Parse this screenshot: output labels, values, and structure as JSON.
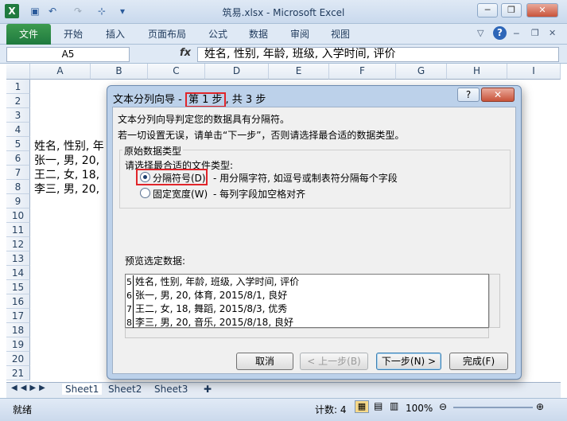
{
  "window": {
    "title": "筑易.xlsx - Microsoft Excel",
    "logo": "X",
    "qat": [
      "save-icon",
      "undo-icon",
      "redo-icon",
      "format-icon",
      "customize-icon"
    ],
    "controls": {
      "minimize": "─",
      "restore": "❐",
      "close": "✕"
    }
  },
  "ribbon": {
    "tabs": [
      "文件",
      "开始",
      "插入",
      "页面布局",
      "公式",
      "数据",
      "审阅",
      "视图"
    ]
  },
  "formula_bar": {
    "name_box": "A5",
    "fx": "fx",
    "content": "姓名, 性别, 年龄, 班级, 入学时间, 评价"
  },
  "sheet": {
    "columns": [
      "A",
      "B",
      "C",
      "D",
      "E",
      "F",
      "G",
      "H",
      "I"
    ],
    "rows": [
      "1",
      "2",
      "3",
      "4",
      "5",
      "6",
      "7",
      "8",
      "9",
      "10",
      "11",
      "12",
      "13",
      "14",
      "15",
      "16",
      "17",
      "18",
      "19",
      "20",
      "21"
    ],
    "cells": [
      "姓名, 性别, 年",
      "张一, 男, 20,",
      "王二, 女, 18,",
      "李三, 男, 20,"
    ],
    "tabs": [
      "Sheet1",
      "Sheet2",
      "Sheet3"
    ]
  },
  "status": {
    "ready": "就绪",
    "count": "计数: 4",
    "zoom": "100%"
  },
  "dialog": {
    "title_prefix": "文本分列向导 - ",
    "title_step": "第 1 步",
    "title_suffix": ", 共 3 步",
    "help": "?",
    "close": "✕",
    "line1": "文本分列向导判定您的数据具有分隔符。",
    "line2": "若一切设置无误，请单击“下一步”，否则请选择最合适的数据类型。",
    "group_title": "原始数据类型",
    "choose_label": "请选择最合适的文件类型:",
    "options": [
      {
        "label": "分隔符号(D)",
        "desc": "- 用分隔字符, 如逗号或制表符分隔每个字段",
        "checked": true
      },
      {
        "label": "固定宽度(W)",
        "desc": "- 每列字段加空格对齐",
        "checked": false
      }
    ],
    "preview_label": "预览选定数据:",
    "preview_rows": [
      {
        "num": "5",
        "text": "姓名, 性别, 年龄, 班级, 入学时间, 评价"
      },
      {
        "num": "6",
        "text": "张一, 男, 20, 体育, 2015/8/1, 良好"
      },
      {
        "num": "7",
        "text": "王二, 女, 18, 舞蹈, 2015/8/3, 优秀"
      },
      {
        "num": "8",
        "text": "李三, 男, 20, 音乐, 2015/8/18, 良好"
      }
    ],
    "buttons": {
      "cancel": "取消",
      "back": "< 上一步(B)",
      "next": "下一步(N) >",
      "finish": "完成(F)"
    }
  }
}
